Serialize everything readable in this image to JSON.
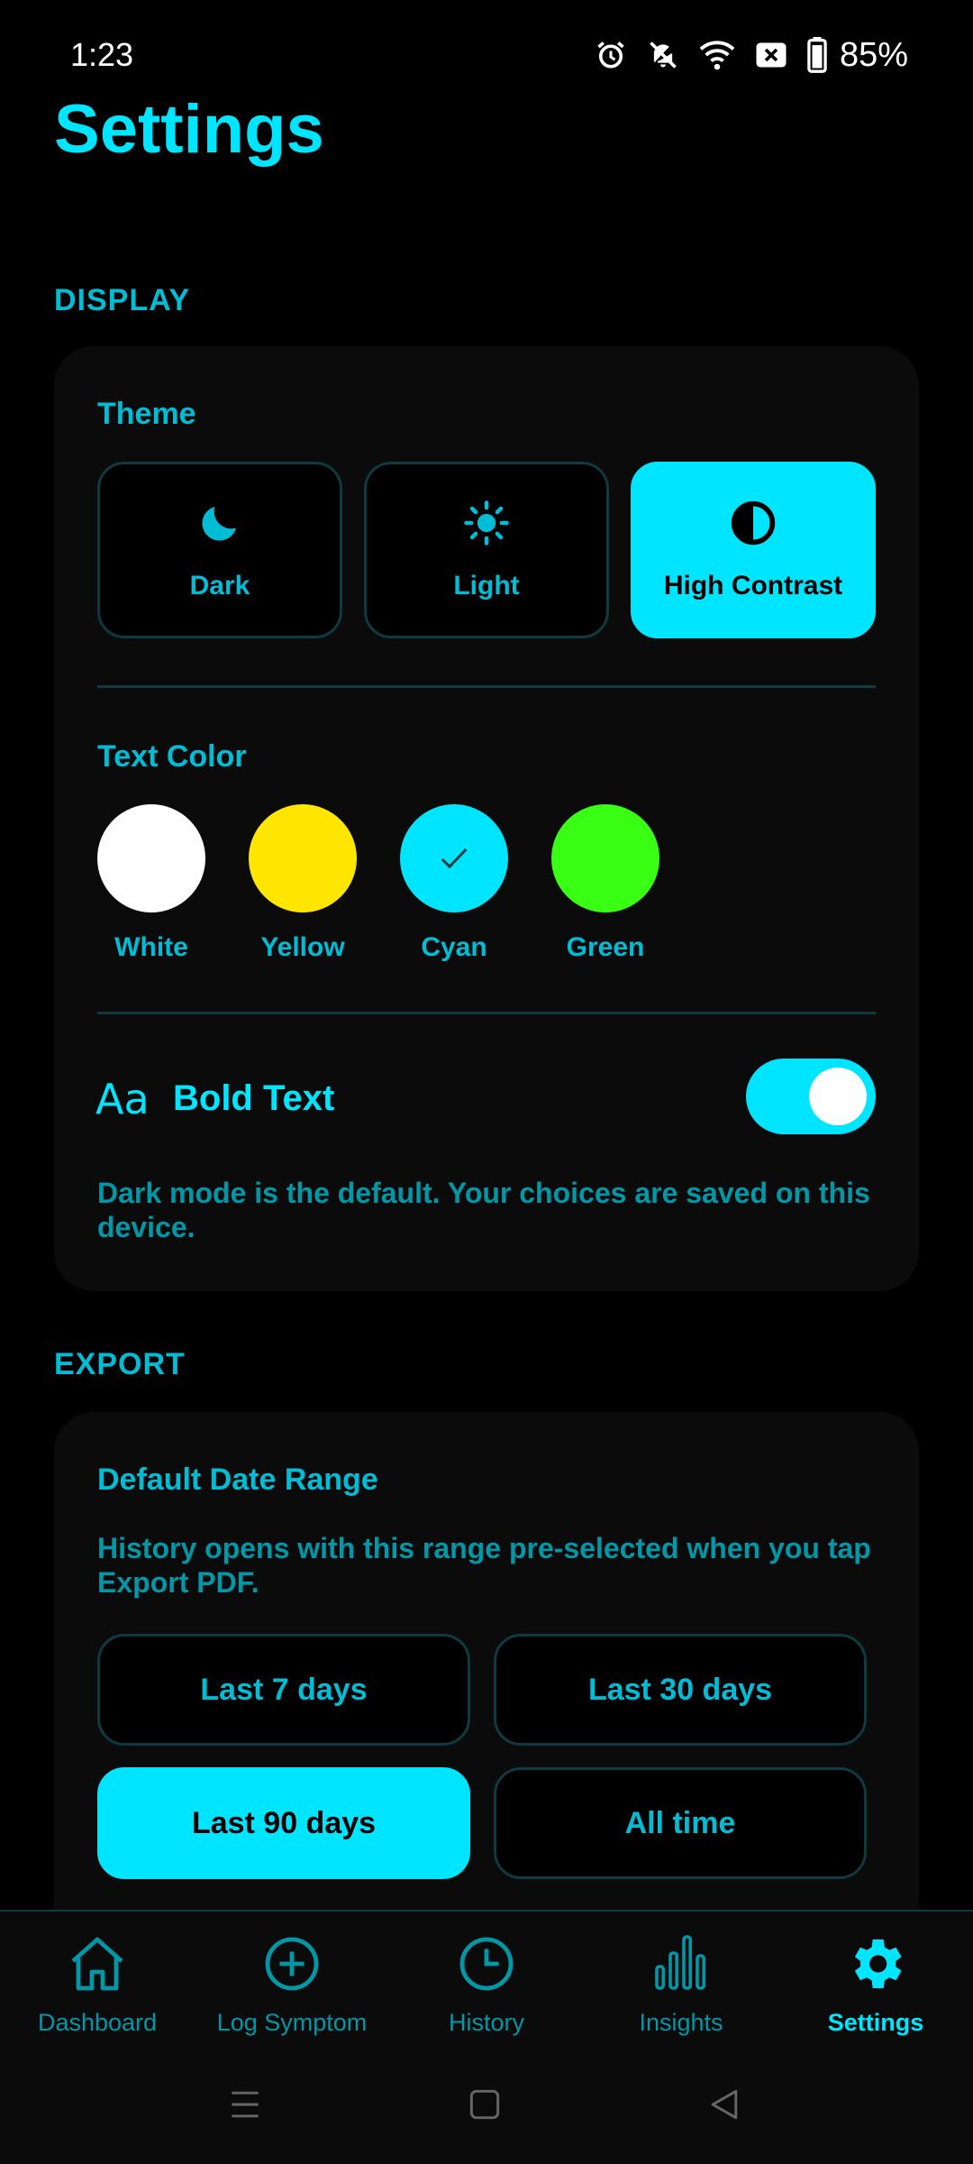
{
  "status_bar": {
    "time": "1:23",
    "battery": "85%"
  },
  "page": {
    "title": "Settings"
  },
  "display": {
    "section_label": "DISPLAY",
    "theme": {
      "label": "Theme",
      "options": [
        {
          "label": "Dark",
          "icon": "moon-icon",
          "selected": false
        },
        {
          "label": "Light",
          "icon": "sun-icon",
          "selected": false
        },
        {
          "label": "High Contrast",
          "icon": "contrast-icon",
          "selected": true
        }
      ]
    },
    "text_color": {
      "label": "Text Color",
      "options": [
        {
          "label": "White",
          "color": "#FFFFFF",
          "selected": false
        },
        {
          "label": "Yellow",
          "color": "#FFE600",
          "selected": false
        },
        {
          "label": "Cyan",
          "color": "#00E5FF",
          "selected": true
        },
        {
          "label": "Green",
          "color": "#39FF14",
          "selected": false
        }
      ]
    },
    "bold_text": {
      "icon_text": "Aa",
      "label": "Bold Text",
      "enabled": true
    },
    "hint": "Dark mode is the default. Your choices are saved on this device."
  },
  "export": {
    "section_label": "EXPORT",
    "default_range": {
      "label": "Default Date Range",
      "hint": "History opens with this range pre-selected when you tap Export PDF.",
      "options": [
        {
          "label": "Last 7 days",
          "selected": false
        },
        {
          "label": "Last 30 days",
          "selected": false
        },
        {
          "label": "Last 90 days",
          "selected": true
        },
        {
          "label": "All time",
          "selected": false
        }
      ]
    }
  },
  "bottom_nav": {
    "items": [
      {
        "label": "Dashboard",
        "icon": "home-icon",
        "active": false
      },
      {
        "label": "Log Symptom",
        "icon": "plus-circle-icon",
        "active": false
      },
      {
        "label": "History",
        "icon": "clock-icon",
        "active": false
      },
      {
        "label": "Insights",
        "icon": "bar-chart-icon",
        "active": false
      },
      {
        "label": "Settings",
        "icon": "gear-icon",
        "active": true
      }
    ]
  },
  "colors": {
    "accent": "#00E5FF",
    "accent_dim": "#00BCD4",
    "background": "#000000",
    "card": "#0B0B0B"
  }
}
